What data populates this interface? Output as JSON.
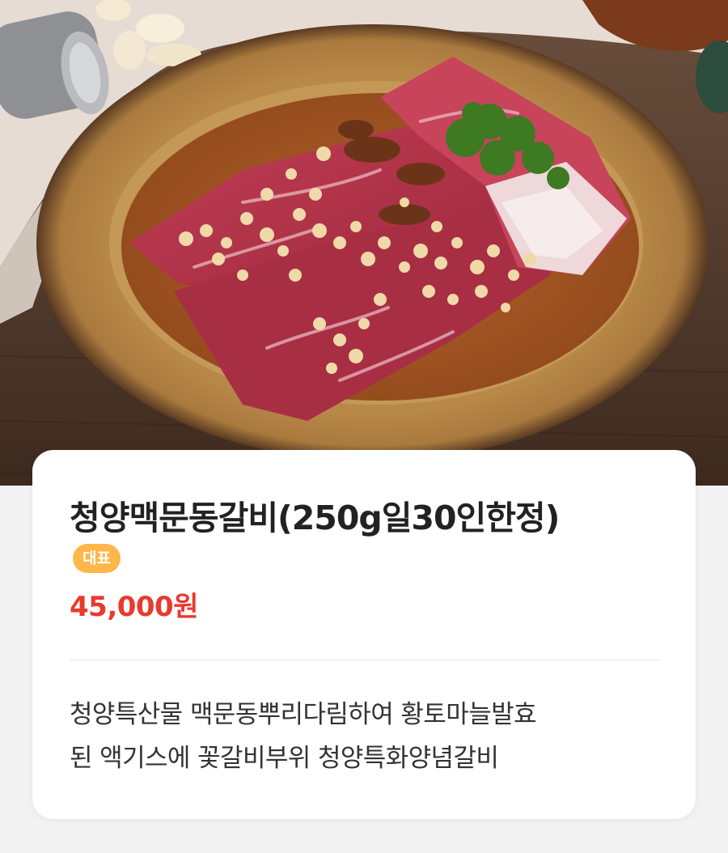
{
  "product": {
    "name": "청양맥문동갈비(250g일30인한정)",
    "badge": "대표",
    "price": "45,000원",
    "description_lines": [
      "청양특산물 맥문동뿌리다림하여 황토마늘발효",
      "된 액기스에 꽃갈비부위 청양특화양념갈비"
    ]
  },
  "colors": {
    "badge": "#ffb64a",
    "price": "#e83a2e",
    "page_background": "#f3f3f3",
    "card_background": "#ffffff"
  }
}
